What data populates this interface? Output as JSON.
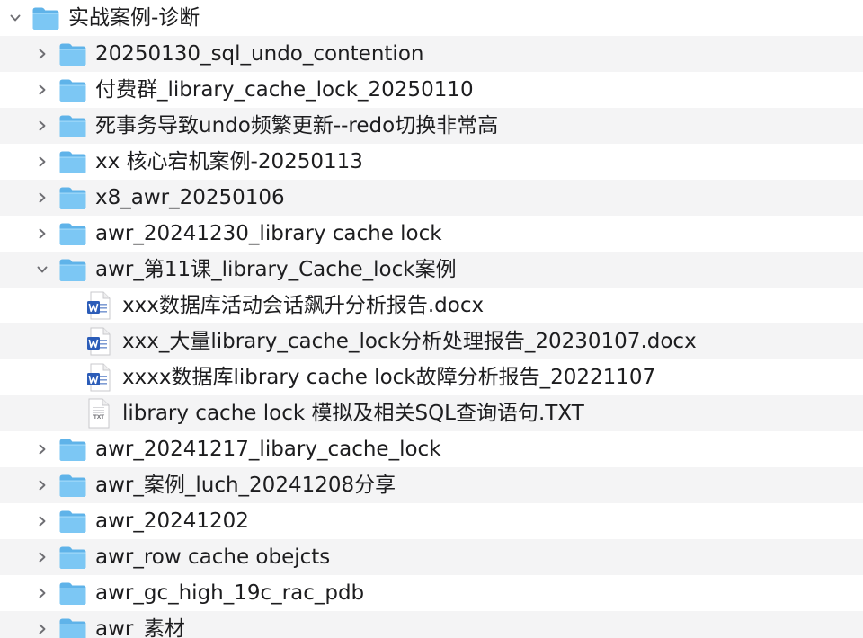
{
  "colors": {
    "folder_back": "#5fb3e9",
    "folder_front": "#7cc7f4",
    "row_alt_bg": "#f4f4f5",
    "text": "#1d1d1f",
    "chevron": "#6e6e73",
    "word_blue": "#2b5cb8"
  },
  "rows": [
    {
      "label": "实战案例-诊断",
      "icon": "folder-icon",
      "expanded": true
    },
    {
      "label": "20250130_sql_undo_contention",
      "icon": "folder-icon",
      "expanded": false
    },
    {
      "label": "付费群_library_cache_lock_20250110",
      "icon": "folder-icon",
      "expanded": false
    },
    {
      "label": "死事务导致undo频繁更新--redo切换非常高",
      "icon": "folder-icon",
      "expanded": false
    },
    {
      "label": "xx 核心宕机案例-20250113",
      "icon": "folder-icon",
      "expanded": false
    },
    {
      "label": "x8_awr_20250106",
      "icon": "folder-icon",
      "expanded": false
    },
    {
      "label": "awr_20241230_library cache lock",
      "icon": "folder-icon",
      "expanded": false
    },
    {
      "label": "awr_第11课_library_Cache_lock案例",
      "icon": "folder-icon",
      "expanded": true
    },
    {
      "label": "xxx数据库活动会话飙升分析报告.docx",
      "icon": "word-doc-icon"
    },
    {
      "label": "xxx_大量library_cache_lock分析处理报告_20230107.docx",
      "icon": "word-doc-icon"
    },
    {
      "label": "xxxx数据库library cache lock故障分析报告_20221107",
      "icon": "word-doc-icon"
    },
    {
      "label": "library cache lock 模拟及相关SQL查询语句.TXT",
      "icon": "txt-file-icon",
      "icon_text": "TXT"
    },
    {
      "label": "awr_20241217_libary_cache_lock",
      "icon": "folder-icon",
      "expanded": false
    },
    {
      "label": "awr_案例_luch_20241208分享",
      "icon": "folder-icon",
      "expanded": false
    },
    {
      "label": "awr_20241202",
      "icon": "folder-icon",
      "expanded": false
    },
    {
      "label": "awr_row cache obejcts",
      "icon": "folder-icon",
      "expanded": false
    },
    {
      "label": "awr_gc_high_19c_rac_pdb",
      "icon": "folder-icon",
      "expanded": false
    },
    {
      "label": "awr_素材",
      "icon": "folder-icon",
      "expanded": false
    }
  ]
}
